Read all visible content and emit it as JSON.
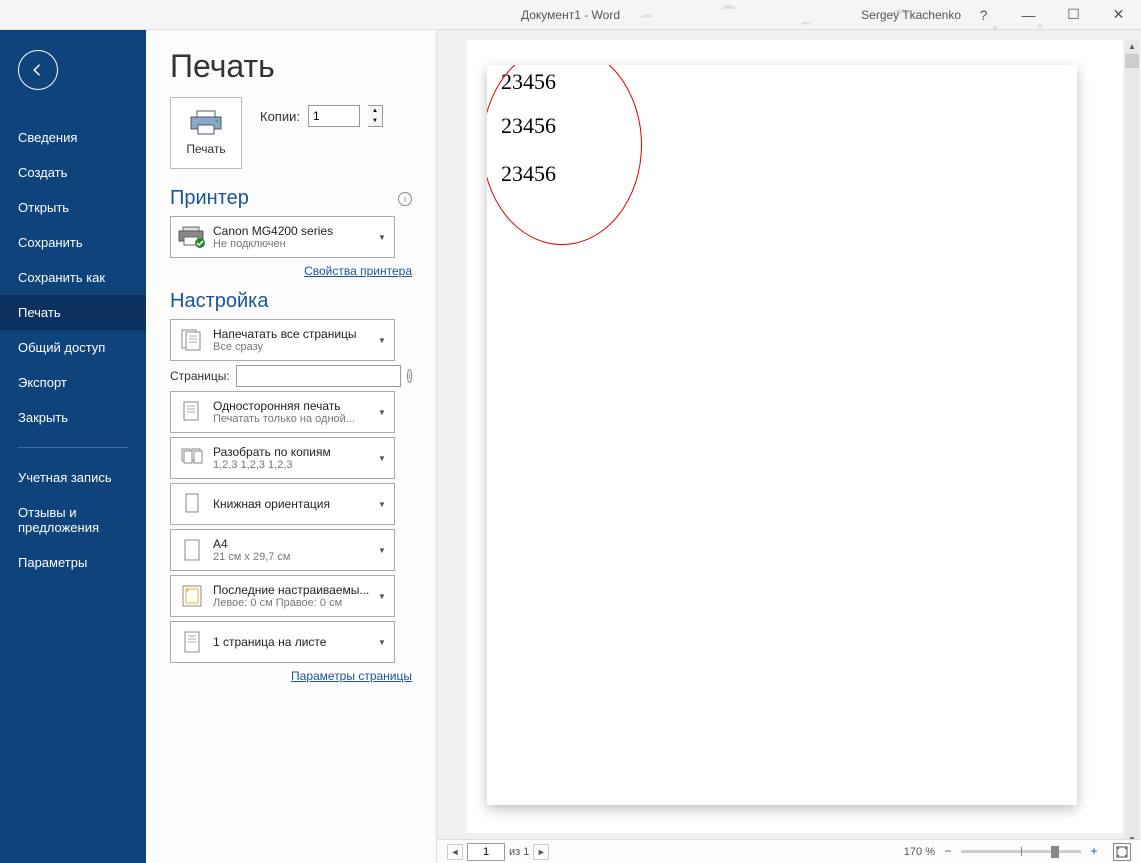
{
  "titlebar": {
    "title": "Документ1  -  Word",
    "user": "Sergey Tkachenko"
  },
  "sidebar": {
    "items": [
      {
        "label": "Сведения"
      },
      {
        "label": "Создать"
      },
      {
        "label": "Открыть"
      },
      {
        "label": "Сохранить"
      },
      {
        "label": "Сохранить как"
      },
      {
        "label": "Печать",
        "active": true
      },
      {
        "label": "Общий доступ"
      },
      {
        "label": "Экспорт"
      },
      {
        "label": "Закрыть"
      }
    ],
    "items2": [
      {
        "label": "Учетная запись"
      },
      {
        "label": "Отзывы и предложения"
      },
      {
        "label": "Параметры"
      }
    ]
  },
  "page": {
    "title": "Печать",
    "print_button": "Печать",
    "copies_label": "Копии:",
    "copies_value": "1",
    "printer_section": "Принтер",
    "printer": {
      "name": "Canon MG4200 series",
      "status": "Не подключен"
    },
    "printer_props_link": "Свойства принтера",
    "settings_section": "Настройка",
    "pages_label": "Страницы:",
    "pages_value": "",
    "dropdowns": {
      "range": {
        "title": "Напечатать все страницы",
        "sub": "Все сразу"
      },
      "sides": {
        "title": "Односторонняя печать",
        "sub": "Печатать только на одной..."
      },
      "collate": {
        "title": "Разобрать по копиям",
        "sub": "1,2,3    1,2,3    1,2,3"
      },
      "orient": {
        "title": "Книжная ориентация",
        "sub": ""
      },
      "size": {
        "title": "A4",
        "sub": "21 см x 29,7 см"
      },
      "margins": {
        "title": "Последние настраиваемы...",
        "sub": "Левое:  0 см   Правое:  0 см"
      },
      "perpage": {
        "title": "1 страница на листе",
        "sub": ""
      }
    },
    "page_setup_link": "Параметры страницы"
  },
  "preview": {
    "lines": [
      "23456",
      "23456",
      "23456"
    ]
  },
  "statusbar": {
    "page_current": "1",
    "page_of": "из 1",
    "zoom": "170 %"
  }
}
